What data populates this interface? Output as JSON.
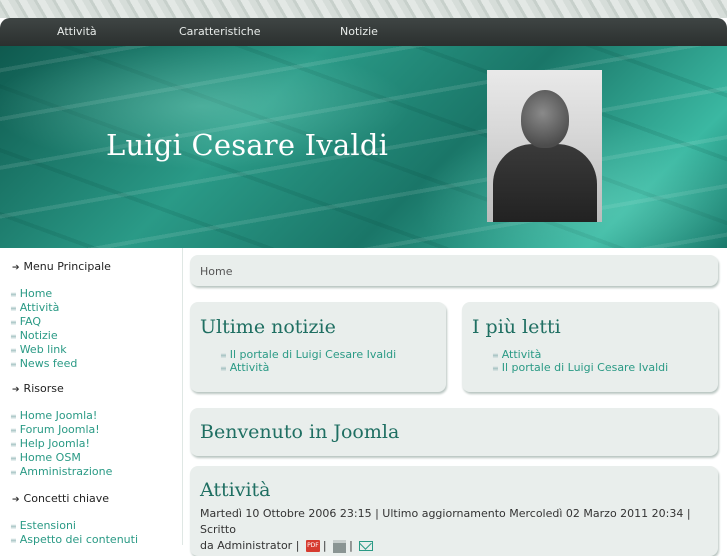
{
  "nav": {
    "items": [
      {
        "label": "Attività"
      },
      {
        "label": "Caratteristiche"
      },
      {
        "label": "Notizie"
      }
    ]
  },
  "header": {
    "site_title": "Luigi Cesare Ivaldi"
  },
  "sidebar": {
    "sections": [
      {
        "heading": "Menu Principale",
        "items": [
          "Home",
          "Attività",
          "FAQ",
          "Notizie",
          "Web link",
          "News feed"
        ]
      },
      {
        "heading": "Risorse",
        "items": [
          "Home Joomla!",
          "Forum Joomla!",
          "Help Joomla!",
          "Home OSM",
          "Amministrazione"
        ]
      },
      {
        "heading": "Concetti chiave",
        "items": [
          "Estensioni",
          "Aspetto dei contenuti"
        ]
      }
    ]
  },
  "breadcrumb": {
    "label": "Home"
  },
  "latest": {
    "title": "Ultime notizie",
    "items": [
      "Il portale di Luigi Cesare Ivaldi",
      "Attività"
    ]
  },
  "popular": {
    "title": "I più letti",
    "items": [
      "Attività",
      "Il portale di Luigi Cesare Ivaldi"
    ]
  },
  "welcome": {
    "title": "Benvenuto in Joomla"
  },
  "article": {
    "title": "Attività",
    "meta_line1": "Martedì 10 Ottobre 2006 23:15 | Ultimo aggiornamento Mercoledì 02 Marzo 2011 20:34 | Scritto",
    "meta_line2": "da Administrator |",
    "pdf_label": "PDF",
    "sep": "|"
  },
  "colors": {
    "accent": "#2a9a85",
    "title_green": "#1f6f62",
    "box_bg": "#e9eeec",
    "nav_bg": "#2f3534"
  }
}
